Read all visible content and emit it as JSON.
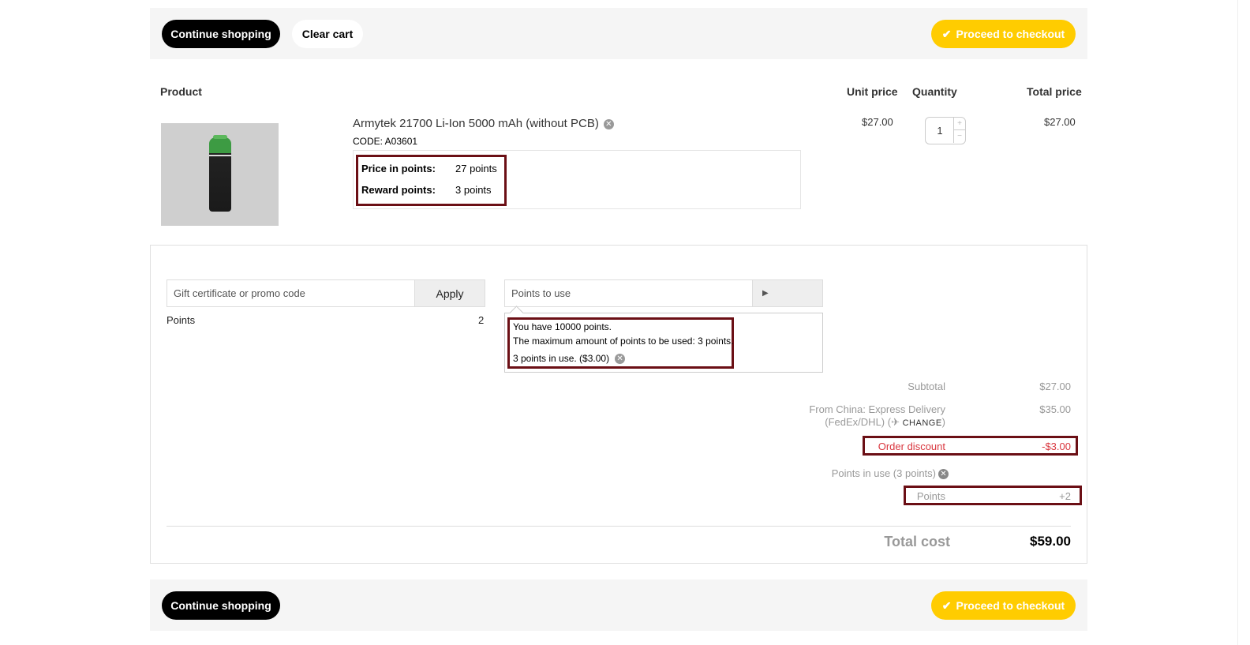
{
  "toolbar": {
    "continue_label": "Continue shopping",
    "clear_label": "Clear cart",
    "checkout_label": "Proceed to checkout"
  },
  "table": {
    "col_product": "Product",
    "col_unit_price": "Unit price",
    "col_quantity": "Quantity",
    "col_total_price": "Total price"
  },
  "item": {
    "name": "Armytek 21700 Li-Ion 5000 mAh (without PCB)",
    "code": "CODE: A03601",
    "price_in_points_label": "Price in points:",
    "price_in_points_value": "27 points",
    "reward_points_label": "Reward points:",
    "reward_points_value": "3 points",
    "unit_price": "$27.00",
    "quantity": "1",
    "total_price": "$27.00"
  },
  "promo": {
    "placeholder": "Gift certificate or promo code",
    "apply_label": "Apply",
    "points_label": "Points",
    "points_value": "2"
  },
  "points_use": {
    "placeholder": "Points to use",
    "go_icon": "play-icon",
    "have": "You have 10000 points.",
    "max": "The maximum amount of points to be used: 3 points.",
    "in_use": "3 points in use. ($3.00)"
  },
  "summary": {
    "subtotal_label": "Subtotal",
    "subtotal_value": "$27.00",
    "shipping_line1": "From China: Express Delivery",
    "shipping_line2": "(FedEx/DHL) (",
    "change_label": "CHANGE",
    "shipping_close": ")",
    "shipping_value": "$35.00",
    "discount_label": "Order discount",
    "discount_value": "-$3.00",
    "points_in_use_label": "Points in use (3 points)",
    "points_label": "Points",
    "points_value": "+2",
    "total_label": "Total cost",
    "total_value": "$59.00"
  },
  "colors": {
    "accent_yellow": "#ffcc00",
    "highlight_frame": "#6b0f15",
    "discount_red": "#d9363e"
  }
}
